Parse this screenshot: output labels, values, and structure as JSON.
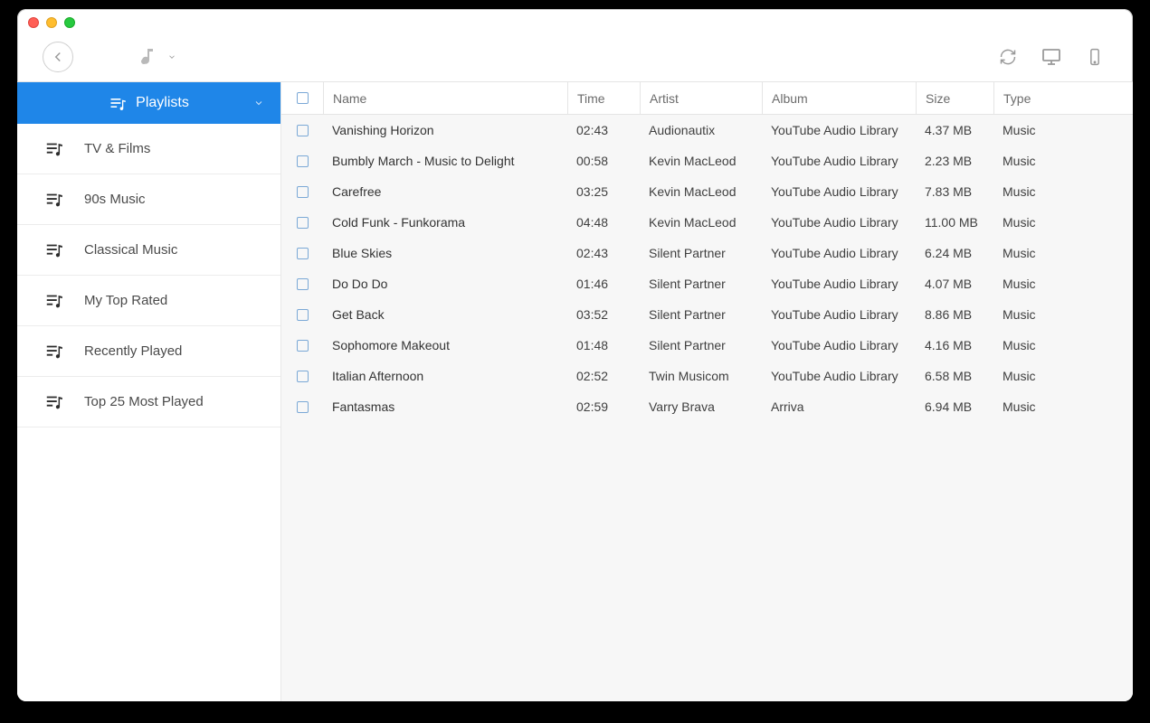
{
  "sidebar": {
    "header": "Playlists",
    "items": [
      {
        "label": "TV & Films"
      },
      {
        "label": "90s Music"
      },
      {
        "label": "Classical Music"
      },
      {
        "label": "My Top Rated"
      },
      {
        "label": "Recently Played"
      },
      {
        "label": "Top 25 Most Played"
      }
    ]
  },
  "columns": {
    "name": "Name",
    "time": "Time",
    "artist": "Artist",
    "album": "Album",
    "size": "Size",
    "type": "Type"
  },
  "tracks": [
    {
      "name": "Vanishing Horizon",
      "time": "02:43",
      "artist": "Audionautix",
      "album": "YouTube Audio Library",
      "size": "4.37 MB",
      "type": "Music"
    },
    {
      "name": "Bumbly March - Music to Delight",
      "time": "00:58",
      "artist": "Kevin MacLeod",
      "album": "YouTube Audio Library",
      "size": "2.23 MB",
      "type": "Music"
    },
    {
      "name": "Carefree",
      "time": "03:25",
      "artist": "Kevin MacLeod",
      "album": "YouTube Audio Library",
      "size": "7.83 MB",
      "type": "Music"
    },
    {
      "name": "Cold Funk - Funkorama",
      "time": "04:48",
      "artist": "Kevin MacLeod",
      "album": "YouTube Audio Library",
      "size": "11.00 MB",
      "type": "Music"
    },
    {
      "name": "Blue Skies",
      "time": "02:43",
      "artist": "Silent Partner",
      "album": "YouTube Audio Library",
      "size": "6.24 MB",
      "type": "Music"
    },
    {
      "name": "Do Do Do",
      "time": "01:46",
      "artist": "Silent Partner",
      "album": "YouTube Audio Library",
      "size": "4.07 MB",
      "type": "Music"
    },
    {
      "name": "Get Back",
      "time": "03:52",
      "artist": "Silent Partner",
      "album": "YouTube Audio Library",
      "size": "8.86 MB",
      "type": "Music"
    },
    {
      "name": "Sophomore Makeout",
      "time": "01:48",
      "artist": "Silent Partner",
      "album": "YouTube Audio Library",
      "size": "4.16 MB",
      "type": "Music"
    },
    {
      "name": "Italian Afternoon",
      "time": "02:52",
      "artist": "Twin Musicom",
      "album": "YouTube Audio Library",
      "size": "6.58 MB",
      "type": "Music"
    },
    {
      "name": "Fantasmas",
      "time": "02:59",
      "artist": "Varry Brava",
      "album": "Arriva",
      "size": "6.94 MB",
      "type": "Music"
    }
  ]
}
